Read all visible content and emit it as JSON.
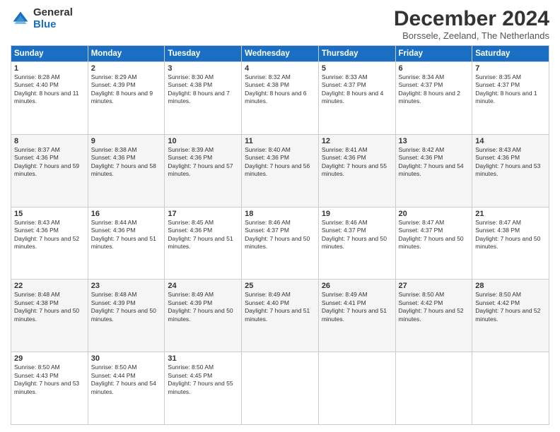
{
  "header": {
    "logo_line1": "General",
    "logo_line2": "Blue",
    "title": "December 2024",
    "subtitle": "Borssele, Zeeland, The Netherlands"
  },
  "weekdays": [
    "Sunday",
    "Monday",
    "Tuesday",
    "Wednesday",
    "Thursday",
    "Friday",
    "Saturday"
  ],
  "weeks": [
    [
      {
        "day": "1",
        "sunrise": "8:28 AM",
        "sunset": "4:40 PM",
        "daylight": "8 hours and 11 minutes."
      },
      {
        "day": "2",
        "sunrise": "8:29 AM",
        "sunset": "4:39 PM",
        "daylight": "8 hours and 9 minutes."
      },
      {
        "day": "3",
        "sunrise": "8:30 AM",
        "sunset": "4:38 PM",
        "daylight": "8 hours and 7 minutes."
      },
      {
        "day": "4",
        "sunrise": "8:32 AM",
        "sunset": "4:38 PM",
        "daylight": "8 hours and 6 minutes."
      },
      {
        "day": "5",
        "sunrise": "8:33 AM",
        "sunset": "4:37 PM",
        "daylight": "8 hours and 4 minutes."
      },
      {
        "day": "6",
        "sunrise": "8:34 AM",
        "sunset": "4:37 PM",
        "daylight": "8 hours and 2 minutes."
      },
      {
        "day": "7",
        "sunrise": "8:35 AM",
        "sunset": "4:37 PM",
        "daylight": "8 hours and 1 minute."
      }
    ],
    [
      {
        "day": "8",
        "sunrise": "8:37 AM",
        "sunset": "4:36 PM",
        "daylight": "7 hours and 59 minutes."
      },
      {
        "day": "9",
        "sunrise": "8:38 AM",
        "sunset": "4:36 PM",
        "daylight": "7 hours and 58 minutes."
      },
      {
        "day": "10",
        "sunrise": "8:39 AM",
        "sunset": "4:36 PM",
        "daylight": "7 hours and 57 minutes."
      },
      {
        "day": "11",
        "sunrise": "8:40 AM",
        "sunset": "4:36 PM",
        "daylight": "7 hours and 56 minutes."
      },
      {
        "day": "12",
        "sunrise": "8:41 AM",
        "sunset": "4:36 PM",
        "daylight": "7 hours and 55 minutes."
      },
      {
        "day": "13",
        "sunrise": "8:42 AM",
        "sunset": "4:36 PM",
        "daylight": "7 hours and 54 minutes."
      },
      {
        "day": "14",
        "sunrise": "8:43 AM",
        "sunset": "4:36 PM",
        "daylight": "7 hours and 53 minutes."
      }
    ],
    [
      {
        "day": "15",
        "sunrise": "8:43 AM",
        "sunset": "4:36 PM",
        "daylight": "7 hours and 52 minutes."
      },
      {
        "day": "16",
        "sunrise": "8:44 AM",
        "sunset": "4:36 PM",
        "daylight": "7 hours and 51 minutes."
      },
      {
        "day": "17",
        "sunrise": "8:45 AM",
        "sunset": "4:36 PM",
        "daylight": "7 hours and 51 minutes."
      },
      {
        "day": "18",
        "sunrise": "8:46 AM",
        "sunset": "4:37 PM",
        "daylight": "7 hours and 50 minutes."
      },
      {
        "day": "19",
        "sunrise": "8:46 AM",
        "sunset": "4:37 PM",
        "daylight": "7 hours and 50 minutes."
      },
      {
        "day": "20",
        "sunrise": "8:47 AM",
        "sunset": "4:37 PM",
        "daylight": "7 hours and 50 minutes."
      },
      {
        "day": "21",
        "sunrise": "8:47 AM",
        "sunset": "4:38 PM",
        "daylight": "7 hours and 50 minutes."
      }
    ],
    [
      {
        "day": "22",
        "sunrise": "8:48 AM",
        "sunset": "4:38 PM",
        "daylight": "7 hours and 50 minutes."
      },
      {
        "day": "23",
        "sunrise": "8:48 AM",
        "sunset": "4:39 PM",
        "daylight": "7 hours and 50 minutes."
      },
      {
        "day": "24",
        "sunrise": "8:49 AM",
        "sunset": "4:39 PM",
        "daylight": "7 hours and 50 minutes."
      },
      {
        "day": "25",
        "sunrise": "8:49 AM",
        "sunset": "4:40 PM",
        "daylight": "7 hours and 51 minutes."
      },
      {
        "day": "26",
        "sunrise": "8:49 AM",
        "sunset": "4:41 PM",
        "daylight": "7 hours and 51 minutes."
      },
      {
        "day": "27",
        "sunrise": "8:50 AM",
        "sunset": "4:42 PM",
        "daylight": "7 hours and 52 minutes."
      },
      {
        "day": "28",
        "sunrise": "8:50 AM",
        "sunset": "4:42 PM",
        "daylight": "7 hours and 52 minutes."
      }
    ],
    [
      {
        "day": "29",
        "sunrise": "8:50 AM",
        "sunset": "4:43 PM",
        "daylight": "7 hours and 53 minutes."
      },
      {
        "day": "30",
        "sunrise": "8:50 AM",
        "sunset": "4:44 PM",
        "daylight": "7 hours and 54 minutes."
      },
      {
        "day": "31",
        "sunrise": "8:50 AM",
        "sunset": "4:45 PM",
        "daylight": "7 hours and 55 minutes."
      },
      null,
      null,
      null,
      null
    ]
  ]
}
